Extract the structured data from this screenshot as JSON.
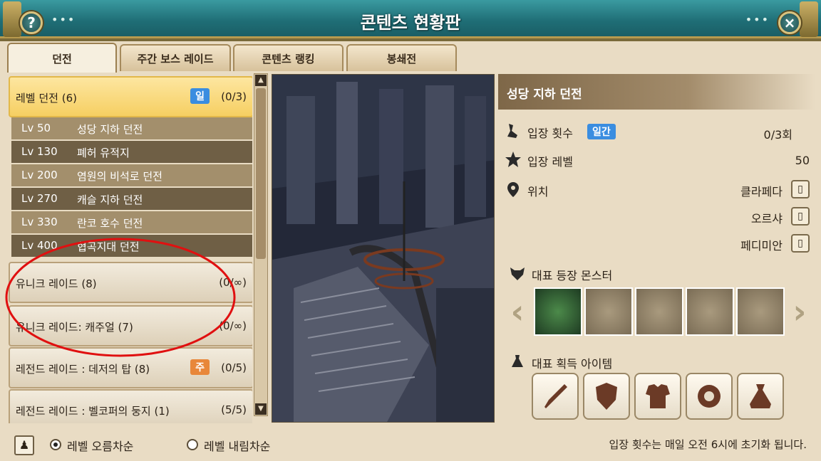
{
  "window": {
    "title": "콘텐츠 현황판",
    "help_icon": "?",
    "close_icon": "×",
    "dots": "•••"
  },
  "tabs": [
    {
      "label": "던전",
      "active": true
    },
    {
      "label": "주간 보스 레이드",
      "active": false
    },
    {
      "label": "콘텐츠 랭킹",
      "active": false
    },
    {
      "label": "봉쇄전",
      "active": false
    }
  ],
  "categories": {
    "level_dungeon": {
      "name": "레벨 던전 (6)",
      "badge": "일",
      "count": "(0/3)"
    },
    "unique_raid": {
      "name": "유니크 레이드 (8)",
      "count": "(0/∞)"
    },
    "unique_raid_casual": {
      "name": "유니크 레이드: 캐주얼 (7)",
      "count": "(0/∞)"
    },
    "legend_raid_1": {
      "name": "레전드 레이드 : 데저의 탑 (8)",
      "badge": "주",
      "count": "(0/5)"
    },
    "legend_raid_2": {
      "name": "레전드 레이드 : 벨코퍼의 둥지 (1)",
      "count": "(5/5)"
    }
  },
  "dungeons": [
    {
      "lv": "Lv 50",
      "name": "성당 지하 던전"
    },
    {
      "lv": "Lv 130",
      "name": "폐허 유적지"
    },
    {
      "lv": "Lv 200",
      "name": "염원의 비석로 던전"
    },
    {
      "lv": "Lv 270",
      "name": "캐슬 지하 던전"
    },
    {
      "lv": "Lv 330",
      "name": "란코 호수 던전"
    },
    {
      "lv": "Lv 400",
      "name": "협곡지대 던전"
    }
  ],
  "detail": {
    "title": "성당 지하 던전",
    "entry_count_label": "입장 횟수",
    "entry_count_badge": "일간",
    "entry_count_value": "0/3회",
    "entry_level_label": "입장 레벨",
    "entry_level_value": "50",
    "location_label": "위치",
    "locations": [
      "클라페다",
      "오르샤",
      "페디미안"
    ],
    "monster_label": "대표 등장 몬스터",
    "item_label": "대표 획득 아이템"
  },
  "bottom": {
    "sort_asc": "레벨 오름차순",
    "sort_desc": "레벨 내림차순",
    "reset_note": "입장 횟수는 매일 오전 6시에 초기화 됩니다."
  },
  "colors": {
    "title_bar": "#1f6e76",
    "active_category": "#f6cf62",
    "badge_blue": "#3a8de0",
    "badge_orange": "#e8873a",
    "annotation": "#e01010"
  }
}
